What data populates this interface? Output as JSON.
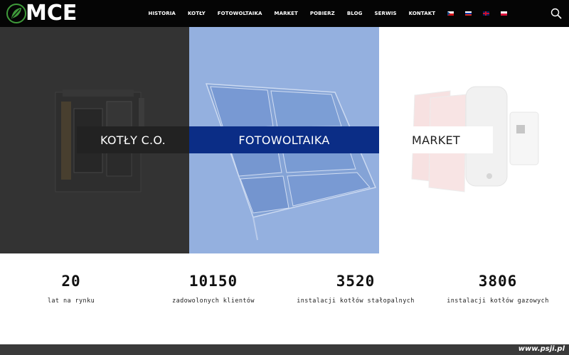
{
  "header": {
    "logo_text": "MCE",
    "nav": [
      {
        "label": "HISTORIA"
      },
      {
        "label": "KOTŁY"
      },
      {
        "label": "FOTOWOLTAIKA"
      },
      {
        "label": "MARKET"
      },
      {
        "label": "POBIERZ"
      },
      {
        "label": "BLOG"
      },
      {
        "label": "SERWIS"
      },
      {
        "label": "KONTAKT"
      }
    ],
    "languages": [
      "cz-flag-icon",
      "ru-flag-icon",
      "gb-flag-icon",
      "pl-flag-icon"
    ],
    "search_icon": "search-icon"
  },
  "panels": [
    {
      "label": "KOTŁY C.O.",
      "bg": "#333333",
      "label_bg": "#222222"
    },
    {
      "label": "FOTOWOLTAIKA",
      "bg": "#94b0df",
      "label_bg": "#0b2d86"
    },
    {
      "label": "MARKET",
      "bg": "#ffffff",
      "label_bg": "#ffffff"
    }
  ],
  "stats": [
    {
      "value": "20",
      "label": "lat na rynku"
    },
    {
      "value": "10150",
      "label": "zadowolonych klientów"
    },
    {
      "value": "3520",
      "label": "instalacji kotłów stałopalnych"
    },
    {
      "value": "3806",
      "label": "instalacji kotłów gazowych"
    }
  ],
  "footer": {
    "watermark": "www.psji.pl"
  },
  "colors": {
    "header": "#050505",
    "accent_green": "#3f9a3a",
    "footer": "#3a3a3a"
  }
}
